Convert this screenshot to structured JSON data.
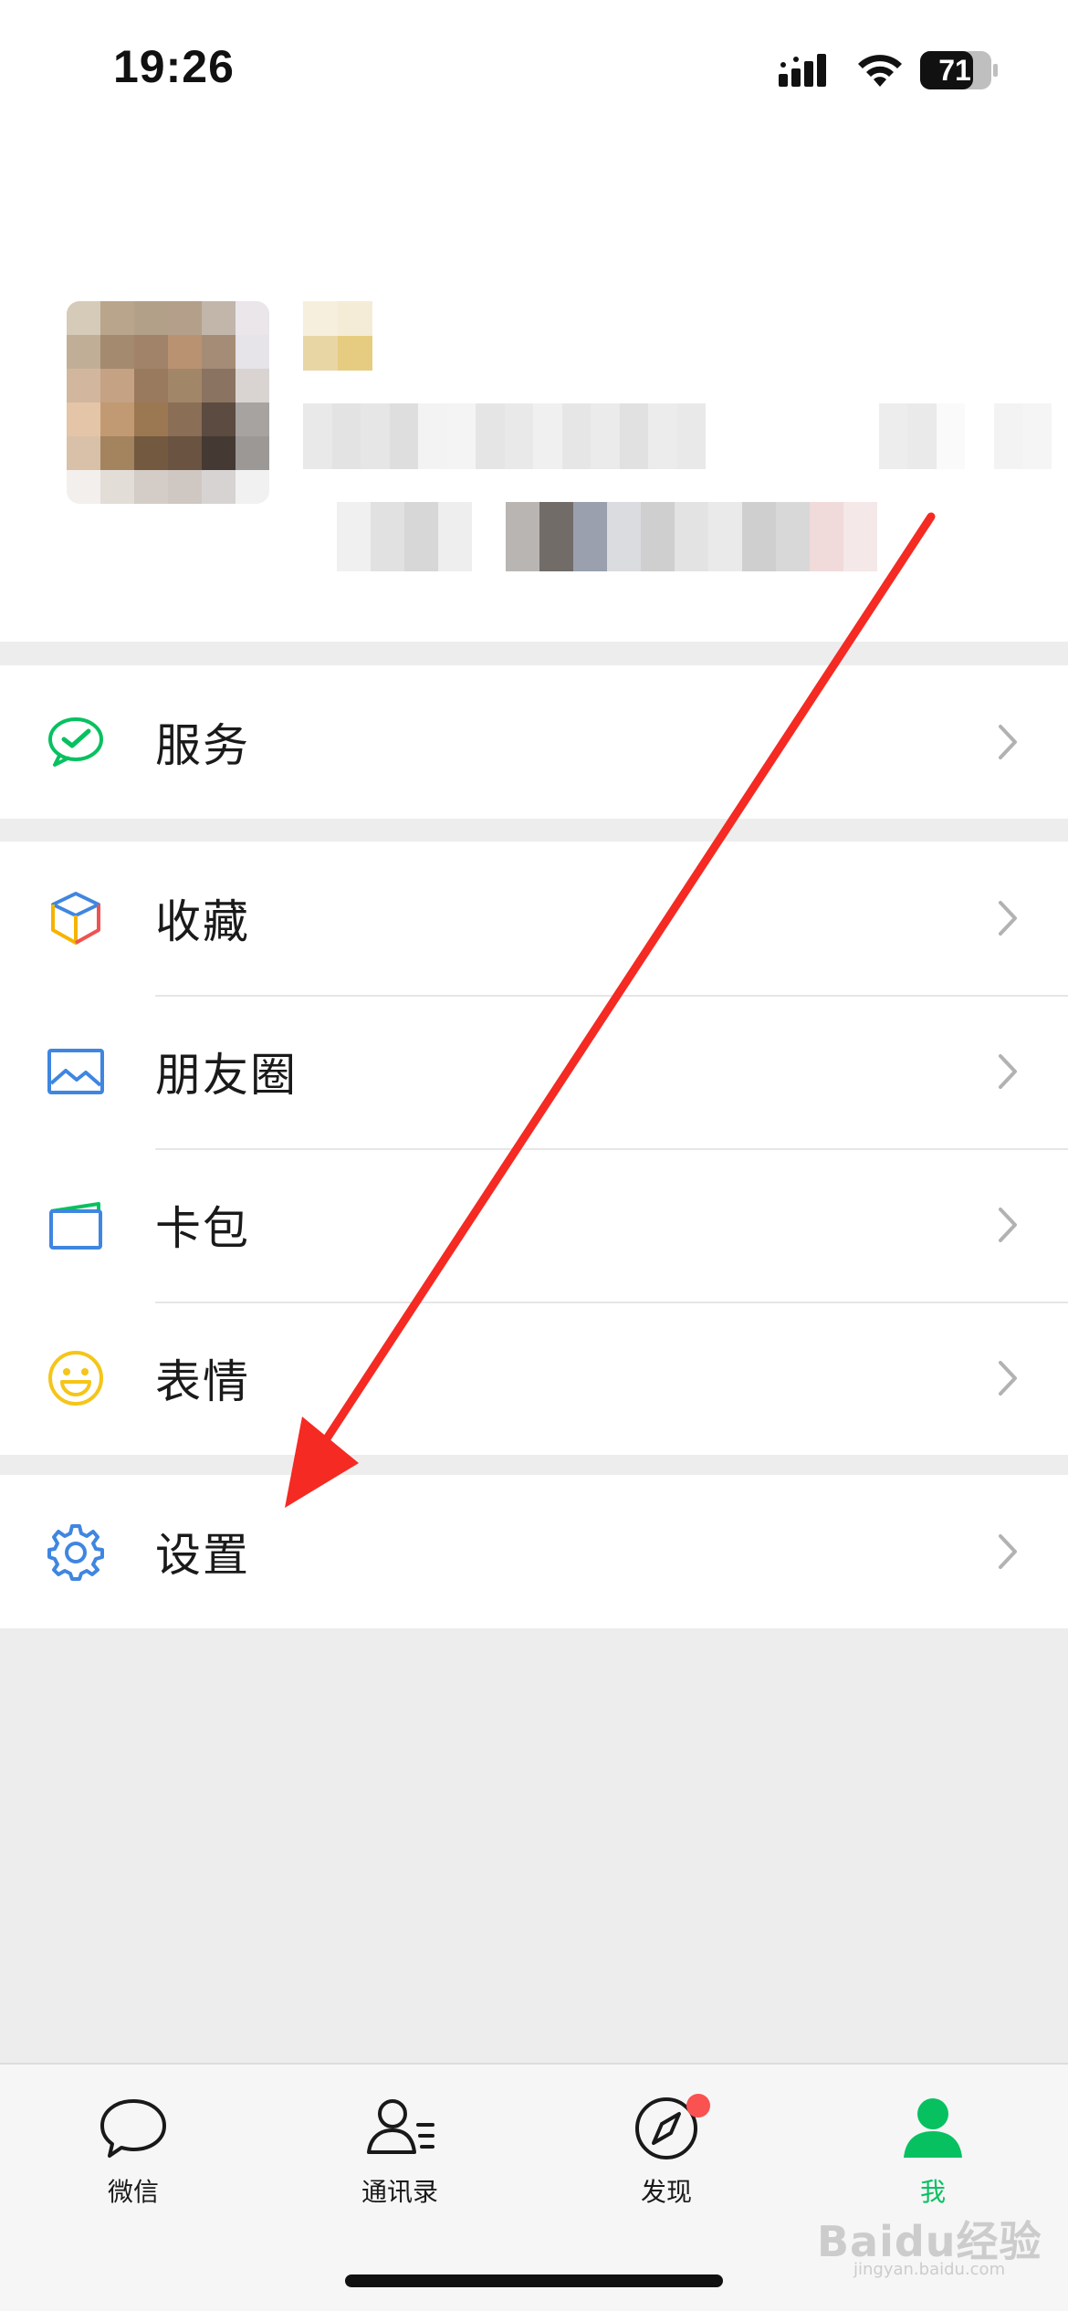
{
  "status_bar": {
    "time": "19:26",
    "battery_level": "71"
  },
  "menu": {
    "services": {
      "label": "服务",
      "icon": "wechat-pay-icon"
    },
    "favorites": {
      "label": "收藏",
      "icon": "cube-icon"
    },
    "moments": {
      "label": "朋友圈",
      "icon": "image-icon"
    },
    "cards": {
      "label": "卡包",
      "icon": "wallet-card-icon"
    },
    "stickers": {
      "label": "表情",
      "icon": "smiley-icon"
    },
    "settings": {
      "label": "设置",
      "icon": "gear-icon"
    }
  },
  "tab_bar": {
    "tabs": [
      {
        "label": "微信",
        "icon": "chat-bubble-icon",
        "active": false
      },
      {
        "label": "通讯录",
        "icon": "contacts-icon",
        "active": false
      },
      {
        "label": "发现",
        "icon": "compass-icon",
        "active": false,
        "badge": true
      },
      {
        "label": "我",
        "icon": "person-icon",
        "active": true
      }
    ]
  },
  "watermark": {
    "brand": "Baidu经验",
    "url": "jingyan.baidu.com"
  },
  "colors": {
    "accent_green": "#07c160",
    "badge_red": "#fa5151",
    "annotation_arrow": "#f52a23"
  }
}
